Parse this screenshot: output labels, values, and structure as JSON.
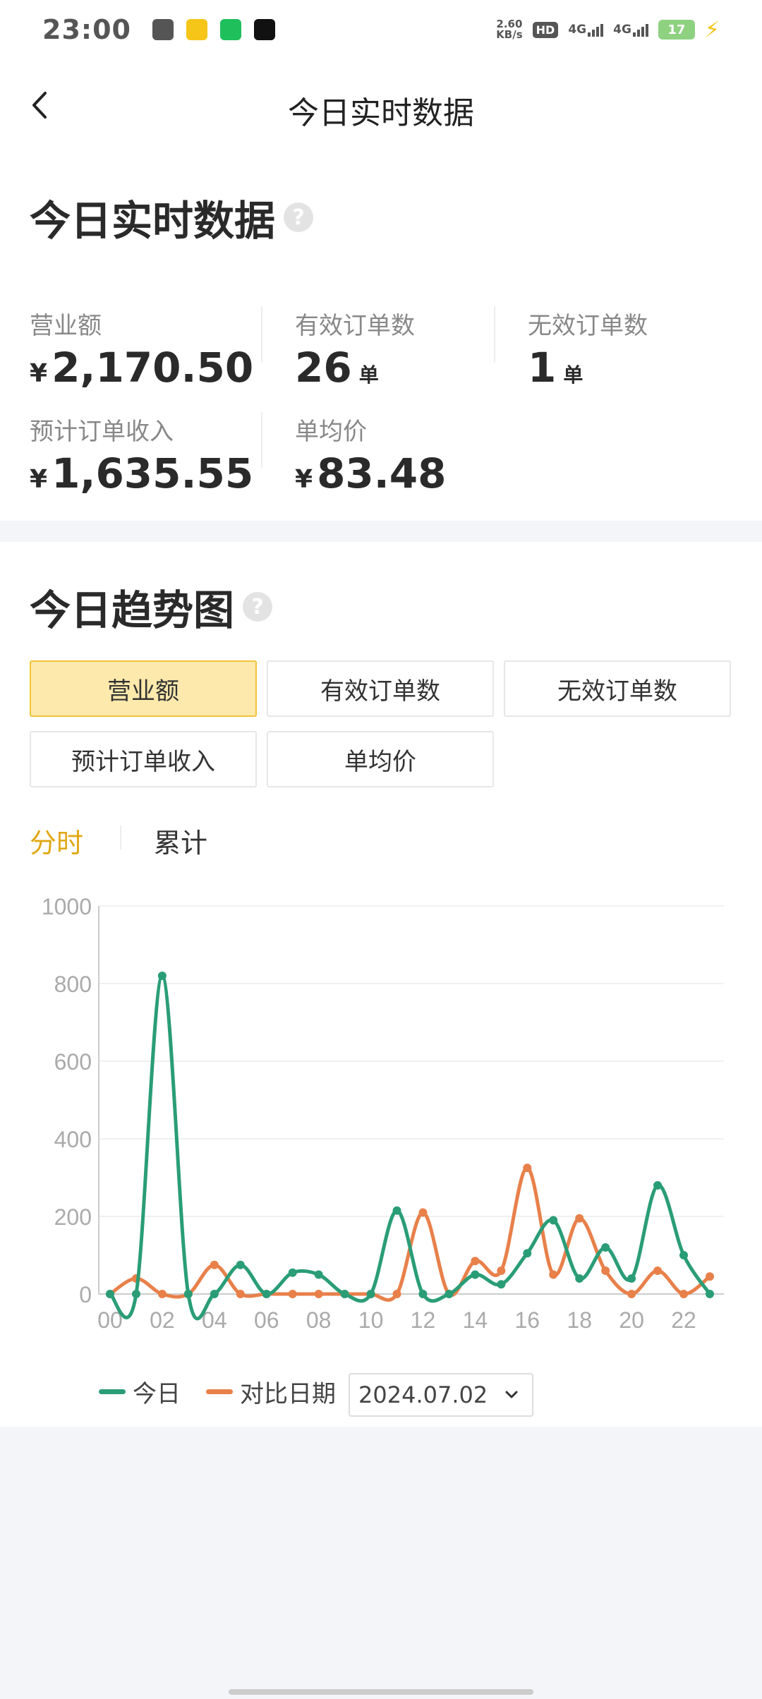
{
  "status_bar": {
    "time": "23:00",
    "speed_value": "2.60",
    "speed_unit": "KB/s",
    "hd": "HD",
    "sim1": "4G",
    "sim2": "4G",
    "battery": "17",
    "app_icons": [
      "scissors-app-icon",
      "yellow-app-icon",
      "green-app-icon",
      "tiktok-icon"
    ]
  },
  "header": {
    "title": "今日实时数据"
  },
  "overview": {
    "title": "今日实时数据",
    "currency": "¥",
    "metrics": {
      "revenue": {
        "label": "营业额",
        "value": "2,170.50"
      },
      "valid_orders": {
        "label": "有效订单数",
        "value": "26",
        "unit": "单"
      },
      "invalid_orders": {
        "label": "无效订单数",
        "value": "1",
        "unit": "单"
      },
      "expected_income": {
        "label": "预计订单收入",
        "value": "1,635.55"
      },
      "avg_price": {
        "label": "单均价",
        "value": "83.48"
      }
    }
  },
  "trend": {
    "title": "今日趋势图",
    "tabs": [
      "营业额",
      "有效订单数",
      "无效订单数",
      "预计订单收入",
      "单均价"
    ],
    "active_tab": "营业额",
    "modes": [
      "分时",
      "累计"
    ],
    "active_mode": "分时",
    "legend_today": "今日",
    "legend_compare": "对比日期",
    "compare_date": "2024.07.02",
    "colors": {
      "today": "#2a9d77",
      "compare": "#e8804a",
      "accent": "#e1a815"
    }
  },
  "chart_data": {
    "type": "line",
    "x": [
      "00",
      "01",
      "02",
      "03",
      "04",
      "05",
      "06",
      "07",
      "08",
      "09",
      "10",
      "11",
      "12",
      "13",
      "14",
      "15",
      "16",
      "17",
      "18",
      "19",
      "20",
      "21",
      "22",
      "23"
    ],
    "xticks": [
      "00",
      "02",
      "04",
      "06",
      "08",
      "10",
      "12",
      "14",
      "16",
      "18",
      "20",
      "22"
    ],
    "ylim": [
      0,
      1000
    ],
    "yticks": [
      0,
      200,
      400,
      600,
      800,
      1000
    ],
    "grid": true,
    "legend": "bottom",
    "series": [
      {
        "name": "今日",
        "values": [
          0,
          0,
          820,
          0,
          0,
          75,
          0,
          55,
          50,
          0,
          0,
          215,
          0,
          0,
          50,
          25,
          105,
          190,
          40,
          120,
          40,
          280,
          100,
          0
        ]
      },
      {
        "name": "对比日期",
        "values": [
          0,
          40,
          0,
          0,
          75,
          0,
          0,
          0,
          0,
          0,
          0,
          0,
          210,
          0,
          85,
          60,
          325,
          50,
          195,
          60,
          0,
          60,
          0,
          45
        ]
      }
    ]
  }
}
